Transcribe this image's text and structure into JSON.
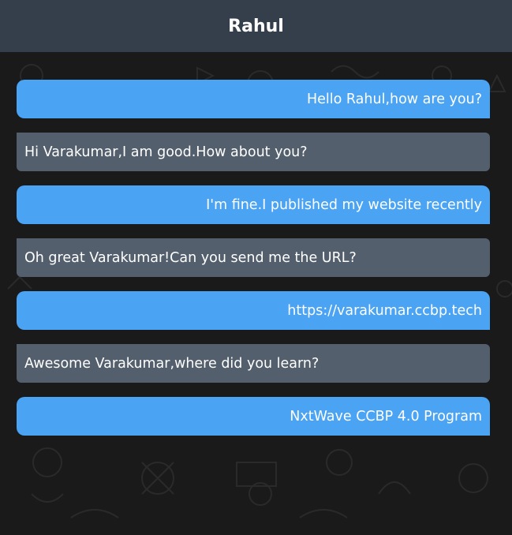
{
  "header": {
    "title": "Rahul"
  },
  "colors": {
    "header_bg": "#343f4b",
    "sent_bubble": "#4aa3f3",
    "received_bubble": "#535f6d",
    "background": "#1a1a1a"
  },
  "messages": [
    {
      "direction": "sent",
      "text": "Hello Rahul,how are you?"
    },
    {
      "direction": "received",
      "text": "Hi Varakumar,I am good.How about you?"
    },
    {
      "direction": "sent",
      "text": "I'm fine.I published my website recently"
    },
    {
      "direction": "received",
      "text": "Oh great Varakumar!Can you send me the URL?"
    },
    {
      "direction": "sent",
      "text": "https://varakumar.ccbp.tech"
    },
    {
      "direction": "received",
      "text": "Awesome Varakumar,where did you learn?"
    },
    {
      "direction": "sent",
      "text": "NxtWave CCBP 4.0 Program"
    }
  ]
}
